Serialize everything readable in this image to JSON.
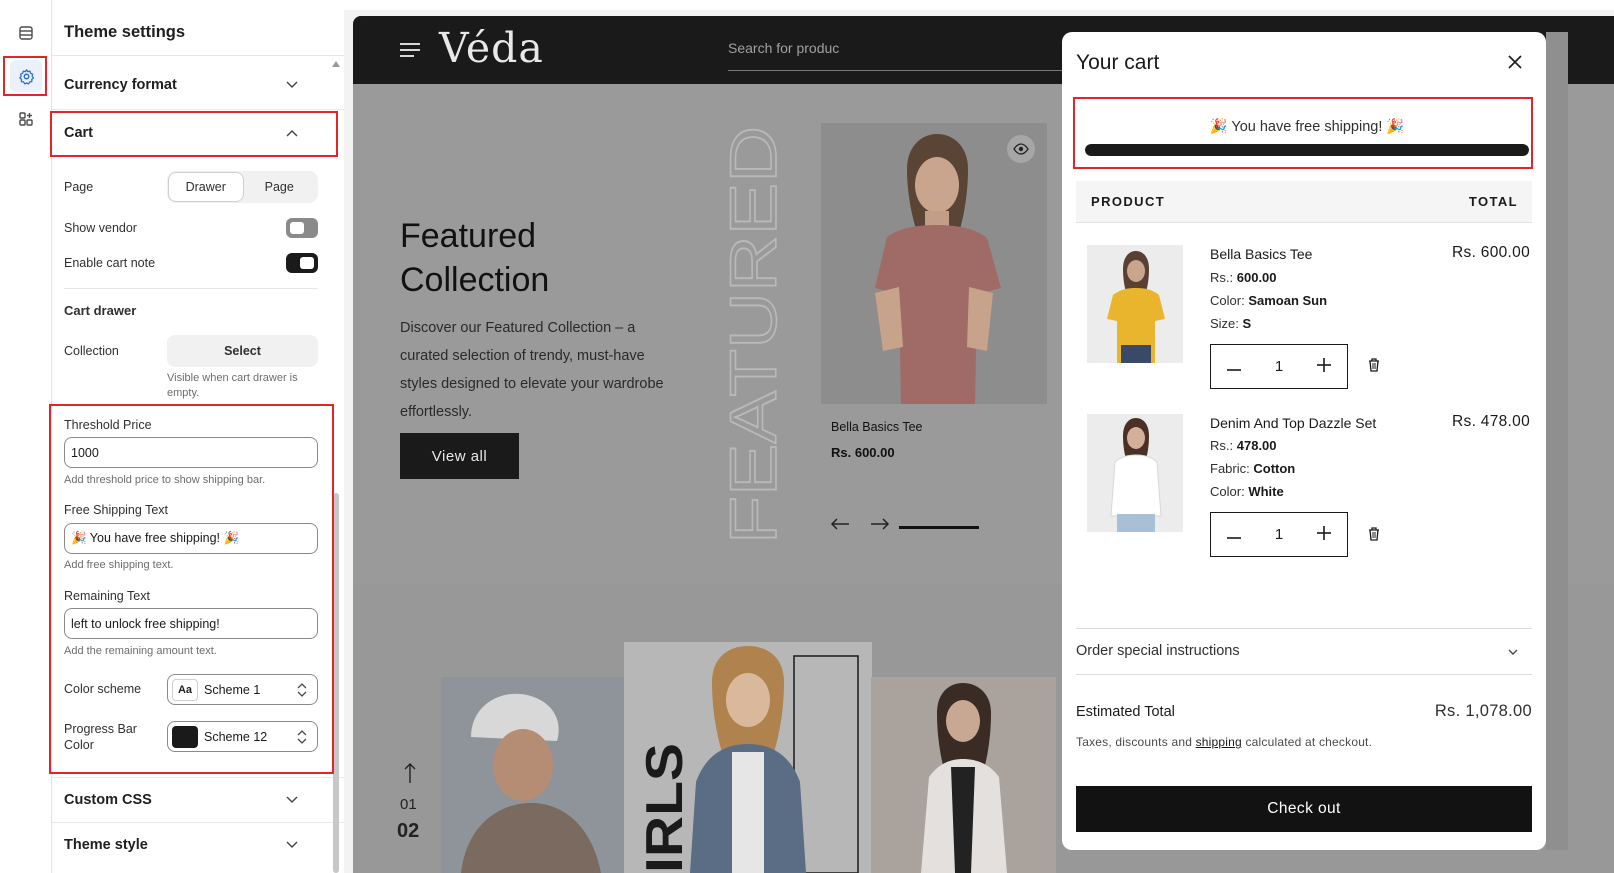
{
  "sidebar": {
    "title": "Theme settings",
    "sections": {
      "currency_format": "Currency format",
      "cart": "Cart",
      "custom_css": "Custom CSS",
      "theme_style": "Theme style"
    },
    "cart": {
      "page_label": "Page",
      "page_options": [
        "Drawer",
        "Page"
      ],
      "page_selected": "Drawer",
      "show_vendor_label": "Show vendor",
      "show_vendor_on": false,
      "cart_note_label": "Enable cart note",
      "cart_note_on": true,
      "drawer_heading": "Cart drawer",
      "collection_label": "Collection",
      "collection_button": "Select",
      "collection_help": "Visible when cart drawer is empty.",
      "threshold_label": "Threshold Price",
      "threshold_value": "1000",
      "threshold_help": "Add threshold price to show shipping bar.",
      "free_text_label": "Free Shipping Text",
      "free_text_value": "🎉 You have free shipping! 🎉",
      "free_text_help": "Add free shipping text.",
      "remaining_label": "Remaining Text",
      "remaining_value": "left to unlock free shipping!",
      "remaining_help": "Add the remaining amount text.",
      "color_scheme_label": "Color scheme",
      "color_scheme_value": "Scheme 1",
      "progress_color_label": "Progress Bar Color",
      "progress_color_value": "Scheme 12"
    }
  },
  "store": {
    "logo": "Véda",
    "search_placeholder": "Search for produc",
    "hero": {
      "title": "Featured Collection",
      "description": "Discover our Featured Collection – a curated selection of trendy, must-have styles designed to elevate your wardrobe effortlessly.",
      "button": "View all",
      "vertical_word": "FEATURED",
      "product_name": "Bella Basics Tee",
      "product_price": "Rs. 600.00"
    },
    "second": {
      "num1": "01",
      "num2": "02",
      "vertical_word": "IRLS"
    }
  },
  "cart": {
    "title": "Your cart",
    "shipping_message": "🎉 You have free shipping! 🎉",
    "shipping_progress": 1.0,
    "col_product": "PRODUCT",
    "col_total": "TOTAL",
    "items": [
      {
        "name": "Bella Basics Tee",
        "price_prefix": "Rs.:",
        "price": "600.00",
        "opt1_label": "Color:",
        "opt1_value": "Samoan Sun",
        "opt2_label": "Size:",
        "opt2_value": "S",
        "quantity": "1",
        "total": "Rs. 600.00"
      },
      {
        "name": "Denim And Top Dazzle Set",
        "price_prefix": "Rs.:",
        "price": "478.00",
        "opt1_label": "Fabric:",
        "opt1_value": "Cotton",
        "opt2_label": "Color:",
        "opt2_value": "White",
        "quantity": "1",
        "total": "Rs. 478.00"
      }
    ],
    "note_label": "Order special instructions",
    "estimated_label": "Estimated Total",
    "estimated_value": "Rs. 1,078.00",
    "tax_before": "Taxes, discounts and ",
    "tax_link": "shipping",
    "tax_after": " calculated at checkout.",
    "checkout": "Check out"
  },
  "colors": {
    "highlight": "#e0262b",
    "accent": "#2c6ecb",
    "dark": "#1a1a1a"
  }
}
